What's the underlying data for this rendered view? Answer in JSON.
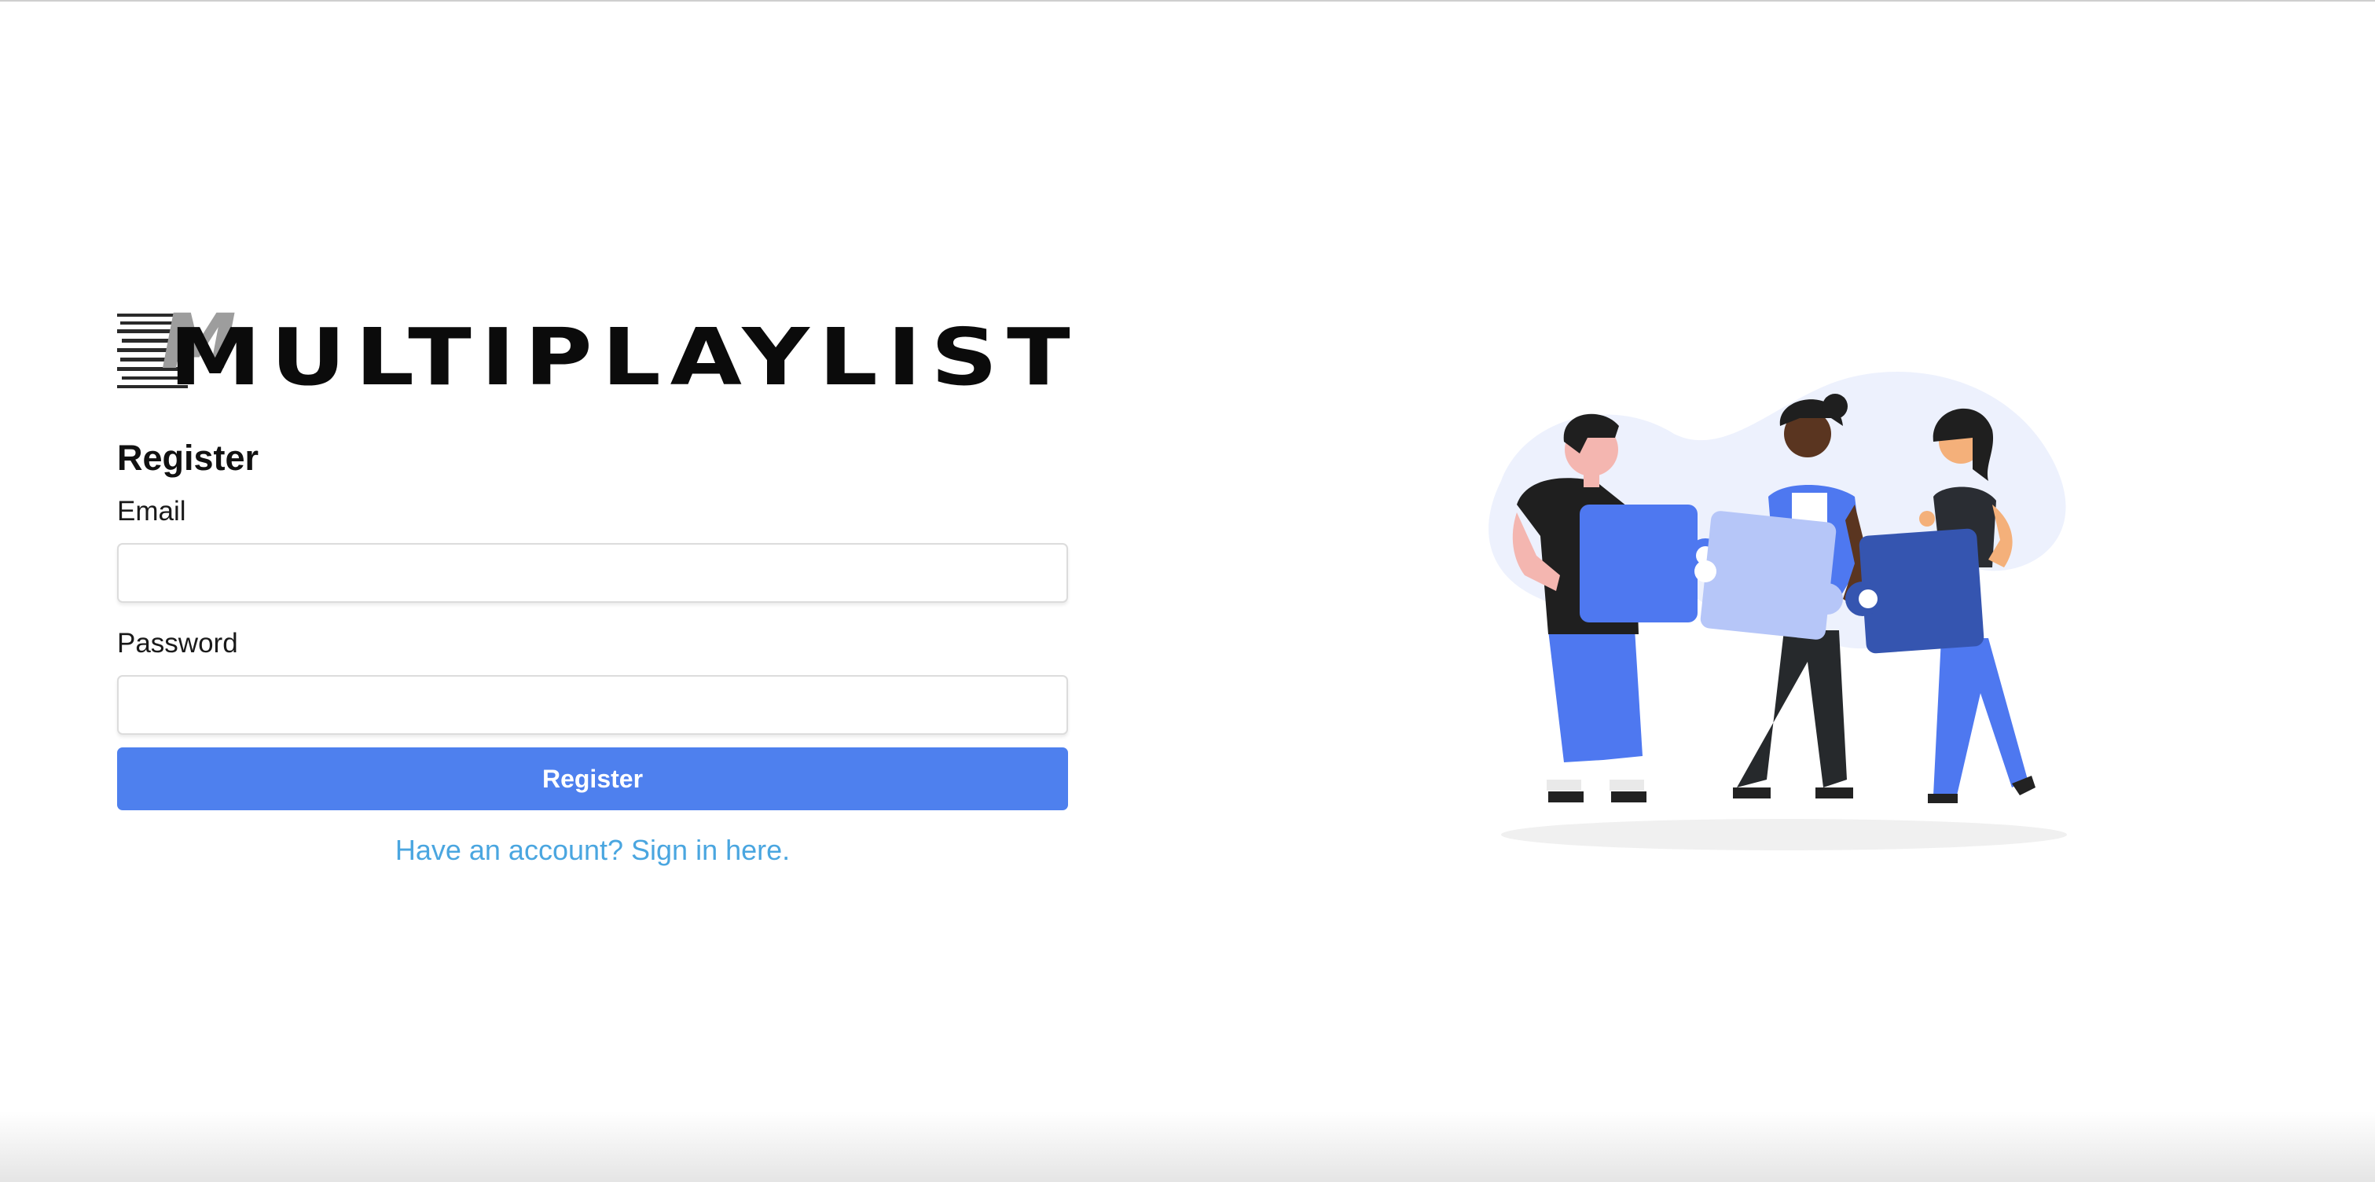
{
  "app": {
    "logo_text": "MULTIPLAYLIST"
  },
  "form": {
    "title": "Register",
    "email_label": "Email",
    "email_value": "",
    "password_label": "Password",
    "password_value": "",
    "submit_label": "Register",
    "signin_link": "Have an account? Sign in here."
  },
  "illustration": {
    "icon": "team-puzzle-illustration",
    "colors": {
      "primary_blue": "#4e78f0",
      "light_blue": "#b6c6f8",
      "dark_blue": "#3555b0",
      "blob": "#edf1fd"
    }
  },
  "colors": {
    "button": "#4e80ee",
    "link": "#4aa6e0",
    "text": "#111111"
  }
}
